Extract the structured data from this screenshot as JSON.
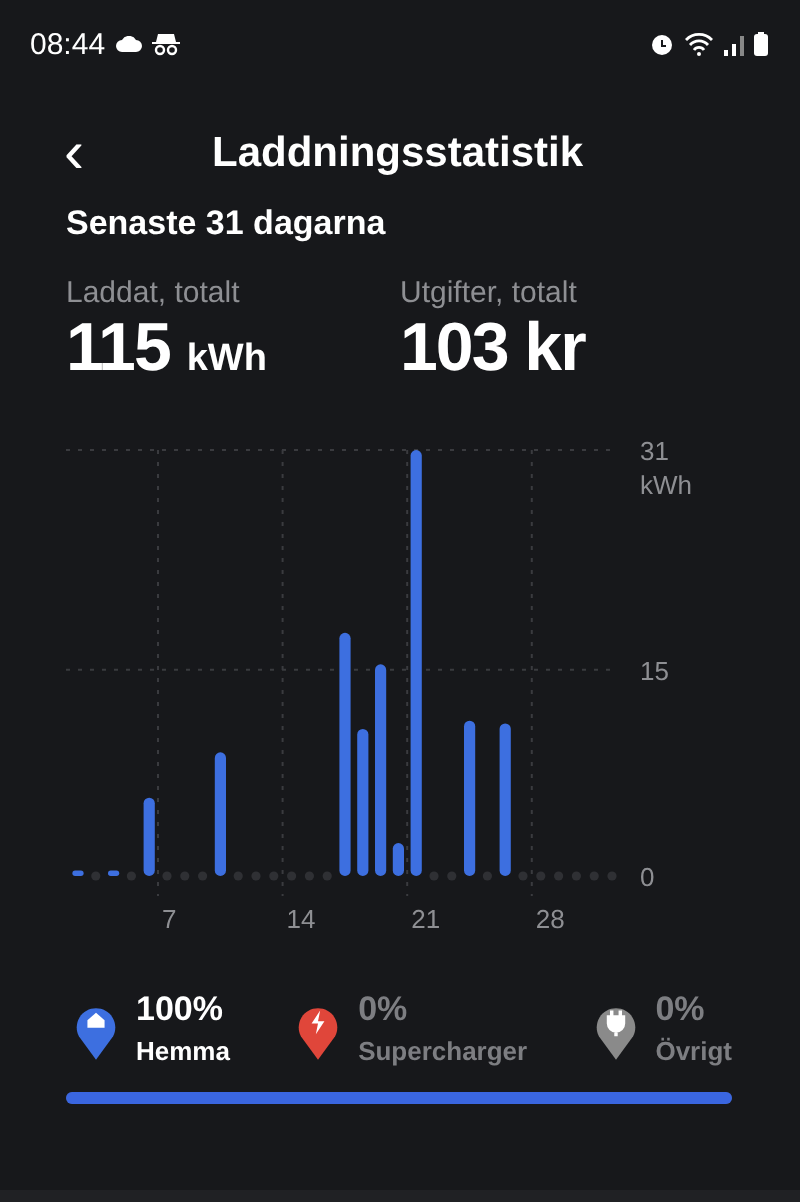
{
  "status_bar": {
    "time": "08:44"
  },
  "header": {
    "back": "‹",
    "title": "Laddningsstatistik"
  },
  "period": "Senaste 31 dagarna",
  "totals": [
    {
      "label": "Laddat, totalt",
      "value": "115",
      "unit": "kWh"
    },
    {
      "label": "Utgifter, totalt",
      "value": "103 kr"
    }
  ],
  "chart": {
    "unit": "kWh",
    "chart_data": {
      "type": "bar",
      "categories": [
        null,
        null,
        null,
        null,
        null,
        "7",
        null,
        null,
        null,
        null,
        null,
        null,
        "14",
        null,
        null,
        null,
        null,
        null,
        null,
        "21",
        null,
        null,
        null,
        null,
        null,
        null,
        "28",
        null,
        null,
        null,
        null
      ],
      "series": [
        {
          "color": "#3d6fe0",
          "values": [
            0.4,
            0,
            0.4,
            0,
            5.7,
            0,
            0,
            0,
            9,
            0,
            0,
            0,
            0,
            0,
            0,
            17.7,
            10.7,
            15.4,
            2.4,
            31,
            0,
            0,
            11.3,
            0,
            11.1,
            0,
            0,
            0,
            0,
            0,
            0
          ]
        }
      ],
      "ylim": [
        0,
        31
      ],
      "yticks": [
        0,
        15,
        31
      ]
    }
  },
  "legend": [
    {
      "kind": "home",
      "color": "#3d6fe0",
      "percent": "100%",
      "label": "Hemma",
      "active": true
    },
    {
      "kind": "bolt",
      "color": "#e0463a",
      "percent": "0%",
      "label": "Supercharger",
      "active": false
    },
    {
      "kind": "plug",
      "color": "#8a8a8a",
      "percent": "0%",
      "label": "Övrigt",
      "active": false
    }
  ],
  "share_bar": {
    "level": 1
  }
}
